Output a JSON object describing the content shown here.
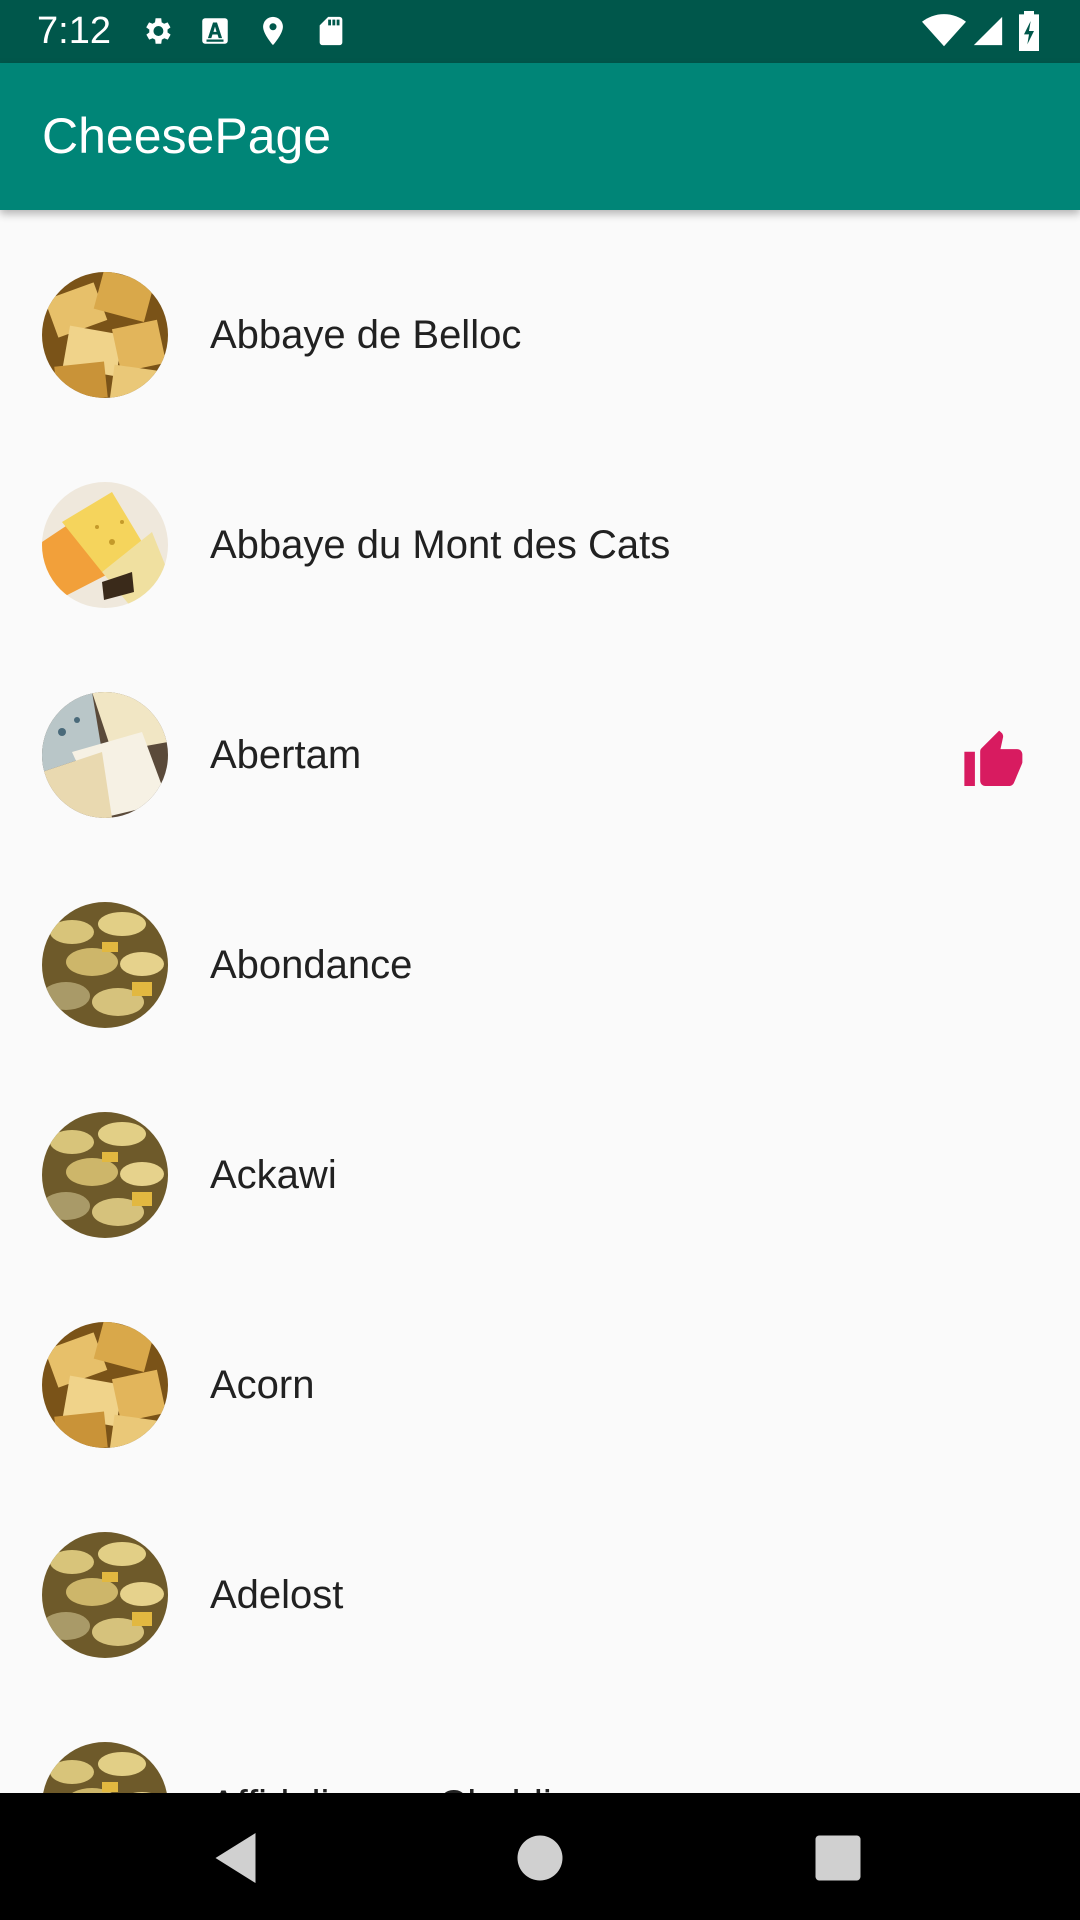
{
  "status_bar": {
    "time": "7:12",
    "icons_left": [
      "gear-icon",
      "text-a-icon",
      "location-pin-icon",
      "sd-card-icon"
    ],
    "icons_right": [
      "wifi-icon",
      "signal-icon",
      "battery-charging-icon"
    ]
  },
  "app_bar": {
    "title": "CheesePage"
  },
  "cheeses": [
    {
      "name": "Abbaye de Belloc",
      "image": "cheese-cubes-photo",
      "liked": false
    },
    {
      "name": "Abbaye du Mont des Cats",
      "image": "cheese-wedges-photo",
      "liked": false
    },
    {
      "name": "Abertam",
      "image": "cheese-assortment-photo",
      "liked": true
    },
    {
      "name": "Abondance",
      "image": "cheese-wheels-photo",
      "liked": false
    },
    {
      "name": "Ackawi",
      "image": "cheese-wheels-photo",
      "liked": false
    },
    {
      "name": "Acorn",
      "image": "cheese-cubes-photo",
      "liked": false
    },
    {
      "name": "Adelost",
      "image": "cheese-wheels-photo",
      "liked": false
    },
    {
      "name": "Affidelice au Chablis",
      "image": "cheese-wheels-photo",
      "liked": false
    }
  ],
  "like_icon": "thumbs-up-icon",
  "colors": {
    "status_bar": "#00574b",
    "app_bar": "#008577",
    "accent": "#d81b60",
    "background": "#fafafa",
    "text": "#212121"
  },
  "nav_bar": {
    "buttons": [
      "back-triangle-icon",
      "home-circle-icon",
      "recents-square-icon"
    ]
  }
}
